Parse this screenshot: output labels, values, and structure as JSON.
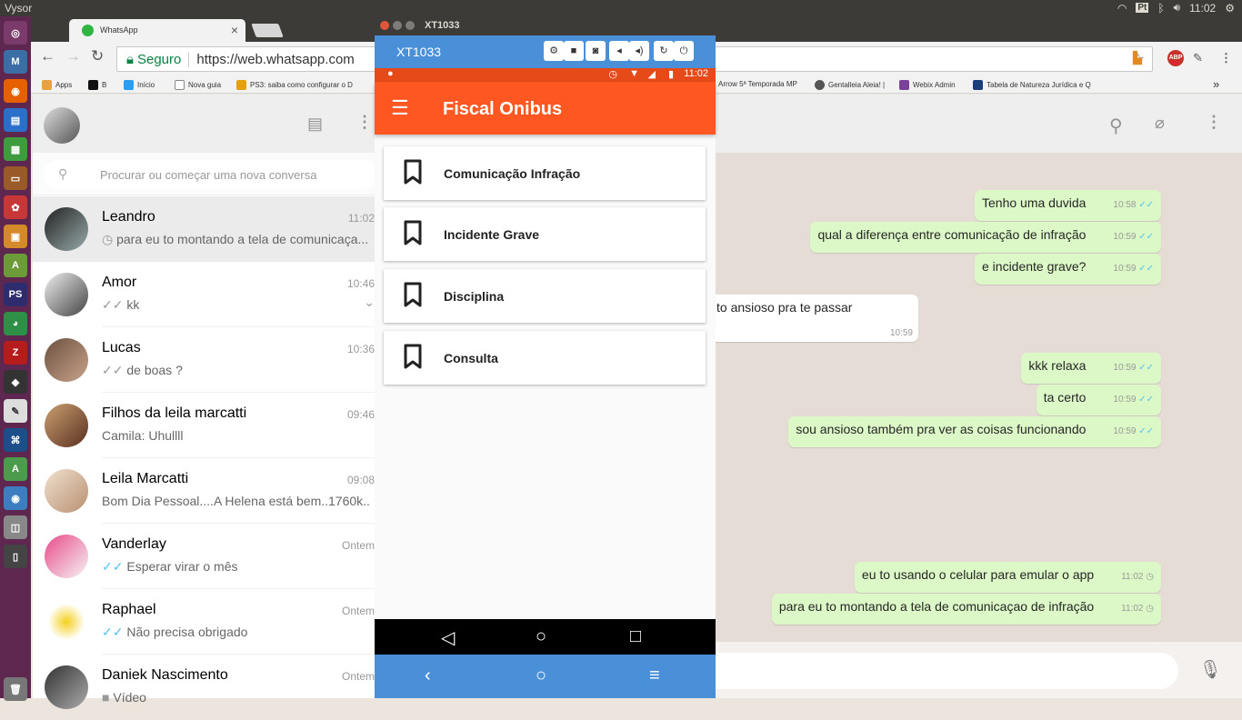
{
  "os": {
    "app_title": "Vysor",
    "keyboard": "Pt",
    "clock": "11:02"
  },
  "browser": {
    "tab_title": "WhatsApp",
    "secure_label": "Seguro",
    "url": "https://web.whatsapp.com",
    "abp_label": "ABP",
    "bookmarks": [
      {
        "label": "Apps",
        "color": "#e8a33d"
      },
      {
        "label": "B",
        "color": "#111111"
      },
      {
        "label": "Início",
        "color": "#2a9df4"
      },
      {
        "label": "Nova guia",
        "color": "#ffffff"
      },
      {
        "label": "PS3: saiba como configurar o D",
        "color": "#e5a00d"
      },
      {
        "label": "Arrow 5ª Temporada MP",
        "color": "#ffffff"
      },
      {
        "label": "Gentalleia Aleia! |",
        "color": "#555555"
      },
      {
        "label": "Webix Admin",
        "color": "#7b4397"
      },
      {
        "label": "Tabela de Natureza Jurídica e Q",
        "color": "#1a3d7c"
      }
    ],
    "bookmarks_more": "»"
  },
  "whatsapp": {
    "search_placeholder": "Procurar ou começar uma nova conversa",
    "chats": [
      {
        "name": "Leandro",
        "time": "11:02",
        "prefix": "◷",
        "prefix_color": "#999999",
        "message": "para eu to montando a tela de comunicaça..."
      },
      {
        "name": "Amor",
        "time": "10:46",
        "prefix": "✓✓",
        "prefix_color": "#999999",
        "message": "kk"
      },
      {
        "name": "Lucas",
        "time": "10:36",
        "prefix": "✓✓",
        "prefix_color": "#999999",
        "message": "de boas ?"
      },
      {
        "name": "Filhos da leila marcatti",
        "time": "09:46",
        "prefix": "",
        "prefix_color": "#999999",
        "message": "Camila: Uhullll"
      },
      {
        "name": "Leila Marcatti",
        "time": "09:08",
        "prefix": "",
        "prefix_color": "#999999",
        "message": "Bom Dia Pessoal....A Helena está bem..1760k..."
      },
      {
        "name": "Vanderlay",
        "time": "Ontem",
        "prefix": "✓✓",
        "prefix_color": "#4fc3f7",
        "message": "Esperar virar o mês"
      },
      {
        "name": "Raphael",
        "time": "Ontem",
        "prefix": "✓✓",
        "prefix_color": "#4fc3f7",
        "message": "Não precisa obrigado"
      },
      {
        "name": "Daniek Nascimento",
        "time": "Ontem",
        "prefix": "",
        "prefix_color": "#999999",
        "message": "Vídeo"
      }
    ],
    "messages": [
      {
        "dir": "out",
        "text": "Tenho uma duvida",
        "time": "10:58",
        "status": "✓✓"
      },
      {
        "dir": "out",
        "text": "qual a diferença entre comunicação de infração",
        "time": "10:59",
        "status": "✓✓"
      },
      {
        "dir": "out",
        "text": "e incidente grave?",
        "time": "10:59",
        "status": "✓✓"
      },
      {
        "dir": "in",
        "text": "to ansioso pra te passar",
        "time": "10:59",
        "status": ""
      },
      {
        "dir": "out",
        "text": "kkk relaxa",
        "time": "10:59",
        "status": "✓✓"
      },
      {
        "dir": "out",
        "text": "ta certo",
        "time": "10:59",
        "status": "✓✓"
      },
      {
        "dir": "out",
        "text": "sou ansioso também pra ver as coisas funcionando",
        "time": "10:59",
        "status": "✓✓"
      },
      {
        "dir": "out",
        "text": "eu to usando o celular para emular o app",
        "time": "11:02",
        "status": "◷"
      },
      {
        "dir": "out",
        "text": "para eu to montando a tela de comunicaçao de infração",
        "time": "11:02",
        "status": "◷"
      }
    ]
  },
  "emulator": {
    "window_title": "XT1033",
    "device_name": "XT1033",
    "phone_clock": "11:02",
    "app_title": "Fiscal Onibus",
    "menu_items": [
      {
        "label": "Comunicação Infração"
      },
      {
        "label": "Incidente Grave"
      },
      {
        "label": "Disciplina"
      },
      {
        "label": "Consulta"
      }
    ]
  }
}
